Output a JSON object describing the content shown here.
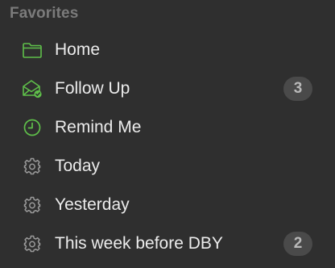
{
  "section": {
    "title": "Favorites"
  },
  "colors": {
    "accent_green": "#5fbf4a",
    "gear_gray": "#9a9a9a",
    "badge_bg": "#4a4a4a",
    "badge_text": "#b9b9b9",
    "background": "#2f2f2f"
  },
  "items": [
    {
      "label": "Home",
      "icon": "folder-icon"
    },
    {
      "label": "Follow Up",
      "icon": "envelope-check-icon",
      "badge": "3"
    },
    {
      "label": "Remind Me",
      "icon": "clock-icon"
    },
    {
      "label": "Today",
      "icon": "gear-icon"
    },
    {
      "label": "Yesterday",
      "icon": "gear-icon"
    },
    {
      "label": "This week before DBY",
      "icon": "gear-icon",
      "badge": "2"
    }
  ]
}
